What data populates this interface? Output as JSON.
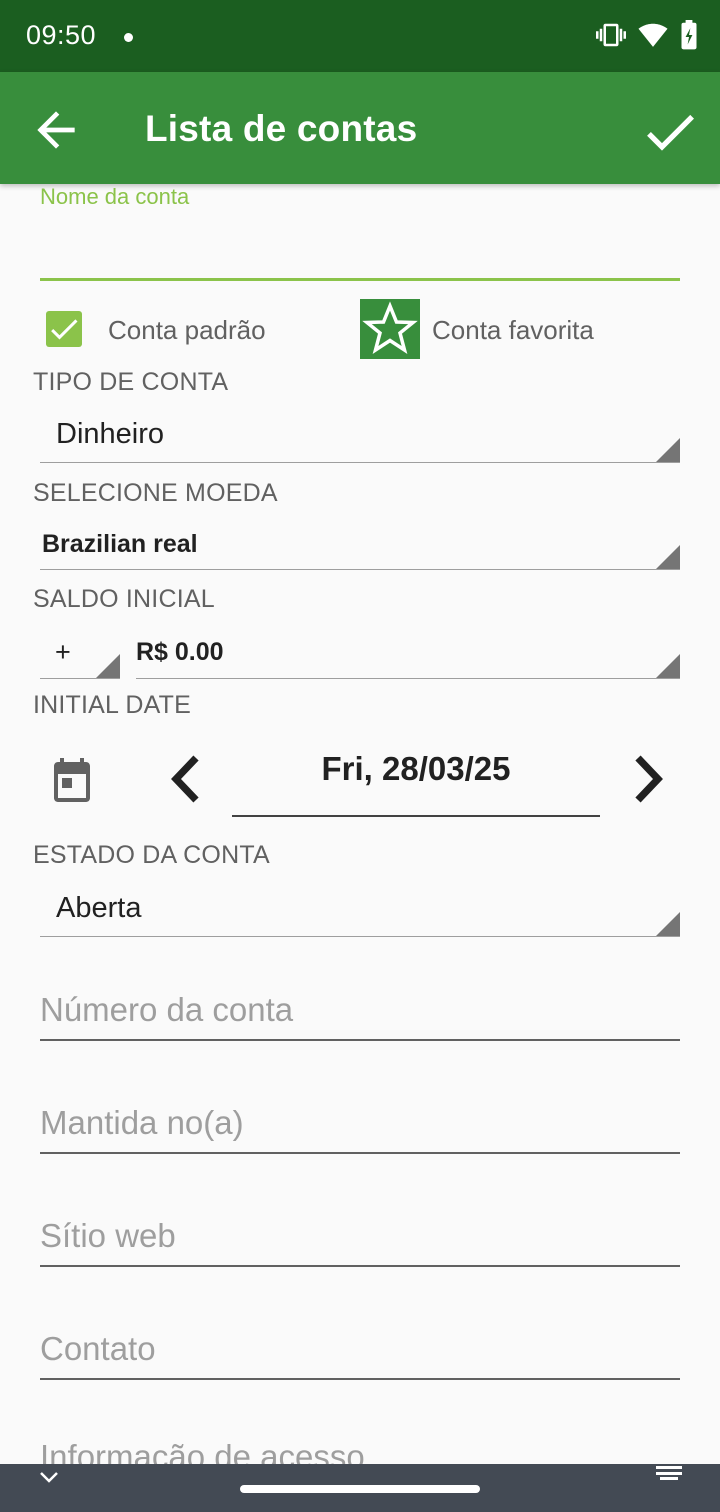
{
  "status_bar": {
    "time": "09:50"
  },
  "app_bar": {
    "title": "Lista de contas"
  },
  "form": {
    "account_name": {
      "label": "Nome da conta",
      "value": ""
    },
    "default_account": {
      "label": "Conta padrão",
      "checked": true
    },
    "favorite_account": {
      "label": "Conta favorita",
      "selected": false
    },
    "account_type": {
      "label": "TIPO DE CONTA",
      "value": "Dinheiro"
    },
    "currency": {
      "label": "SELECIONE MOEDA",
      "value": "Brazilian real"
    },
    "initial_balance": {
      "label": "SALDO INICIAL",
      "sign": "+",
      "value": "R$ 0.00"
    },
    "initial_date": {
      "label": "INITIAL DATE",
      "value": "Fri, 28/03/25"
    },
    "account_state": {
      "label": "ESTADO DA CONTA",
      "value": "Aberta"
    },
    "account_number": {
      "placeholder": "Número da conta"
    },
    "held_at": {
      "placeholder": "Mantida no(a)"
    },
    "website": {
      "placeholder": "Sítio web"
    },
    "contact": {
      "placeholder": "Contato"
    },
    "access_info": {
      "placeholder": "Informação de acesso"
    }
  },
  "colors": {
    "status_bar": "#1b5e20",
    "app_bar": "#388e3c",
    "accent": "#8bc34a"
  },
  "icons": {
    "back": "arrow-left-icon",
    "save": "check-icon",
    "checkbox": "checkbox-checked-icon",
    "favorite": "star-outline-icon",
    "calendar": "calendar-icon",
    "prev": "chevron-left-icon",
    "next": "chevron-right-icon"
  }
}
